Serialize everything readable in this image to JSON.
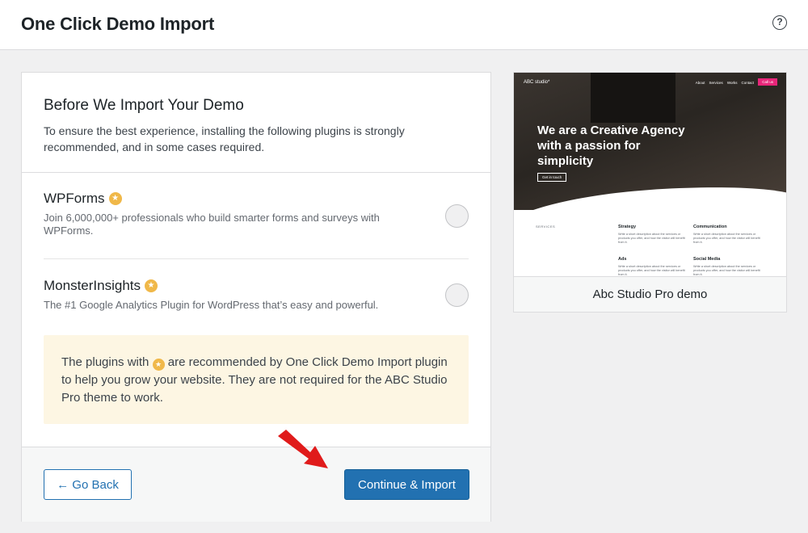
{
  "header": {
    "title": "One Click Demo Import",
    "help_icon": "?"
  },
  "intro": {
    "heading": "Before We Import Your Demo",
    "text": "To ensure the best experience, installing the following plugins is strongly recommended, and in some cases required."
  },
  "plugins": [
    {
      "name": "WPForms",
      "description": "Join 6,000,000+ professionals who build smarter forms and surveys with WPForms.",
      "recommended": true,
      "selected": false
    },
    {
      "name": "MonsterInsights",
      "description": "The #1 Google Analytics Plugin for WordPress that’s easy and powerful.",
      "recommended": true,
      "selected": false
    }
  ],
  "notice": {
    "text_before": "The plugins with",
    "text_after": "are recommended by One Click Demo Import plugin to help you grow your website. They are not required for the ABC Studio Pro theme to work."
  },
  "footer": {
    "back_label": "← Go Back",
    "import_label": "Continue & Import"
  },
  "preview": {
    "brand": "ABC studio*",
    "nav": [
      "About",
      "Services",
      "Works",
      "Contact"
    ],
    "cta": "Call us",
    "hero_title": "We are a Creative Agency with a passion for simplicity",
    "hero_button": "Get in touch",
    "services_label": "SERVICES",
    "columns": [
      {
        "title": "Strategy",
        "text": "Write a short description about the services or products you offer, and how the visitor will benefit from it."
      },
      {
        "title": "Communication",
        "text": "Write a short description about the services or products you offer, and how the visitor will benefit from it."
      },
      {
        "title": "Ads",
        "text": "Write a short description about the services or products you offer, and how the visitor will benefit from it."
      },
      {
        "title": "Social Media",
        "text": "Write a short description about the services or products you offer, and how the visitor will benefit from it."
      }
    ],
    "caption": "Abc Studio Pro demo"
  },
  "colors": {
    "primary": "#2271b1",
    "recommended_star": "#f0b849",
    "notice_bg": "#fdf6e3",
    "arrow": "#e01b1b"
  },
  "icons": {
    "star": "star-badge-icon",
    "help": "help-icon",
    "arrow": "red-arrow-pointer"
  }
}
